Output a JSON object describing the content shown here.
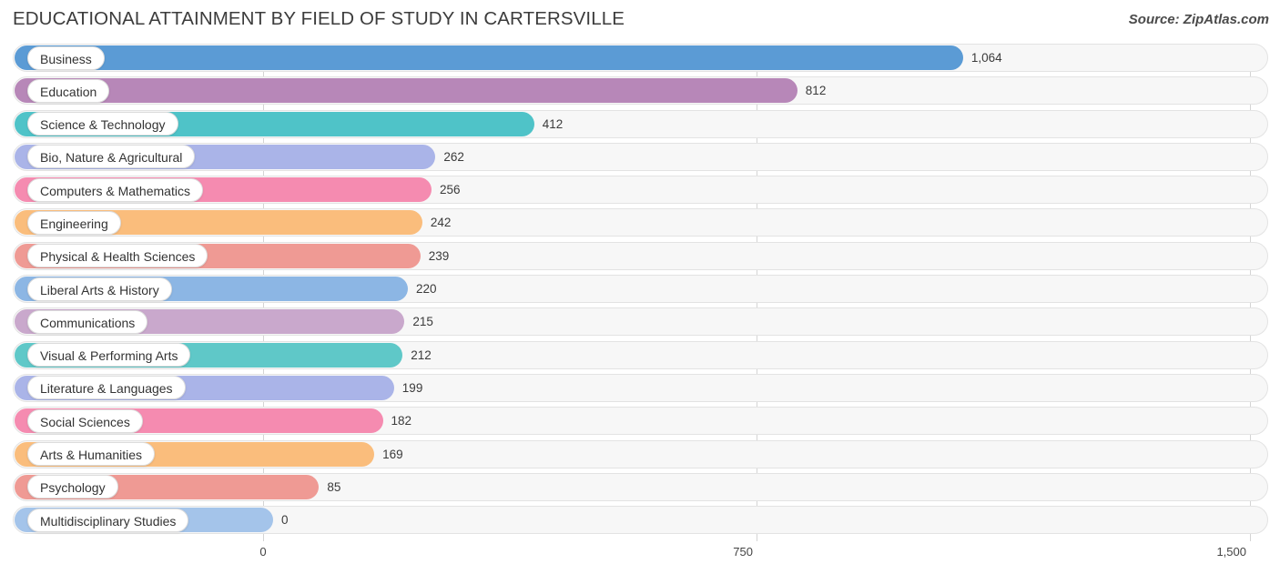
{
  "header": {
    "title": "EDUCATIONAL ATTAINMENT BY FIELD OF STUDY IN CARTERSVILLE",
    "source": "Source: ZipAtlas.com"
  },
  "chart_data": {
    "type": "bar",
    "orientation": "horizontal",
    "title": "EDUCATIONAL ATTAINMENT BY FIELD OF STUDY IN CARTERSVILLE",
    "xlabel": "",
    "ylabel": "",
    "xlim": [
      0,
      1500
    ],
    "grid": true,
    "legend": "none",
    "xticks": [
      "0",
      "750",
      "1,500"
    ],
    "xtick_values": [
      0,
      750,
      1500
    ],
    "categories": [
      "Business",
      "Education",
      "Science & Technology",
      "Bio, Nature & Agricultural",
      "Computers & Mathematics",
      "Engineering",
      "Physical & Health Sciences",
      "Liberal Arts & History",
      "Communications",
      "Visual & Performing Arts",
      "Literature & Languages",
      "Social Sciences",
      "Arts & Humanities",
      "Psychology",
      "Multidisciplinary Studies"
    ],
    "values": [
      1064,
      812,
      412,
      262,
      256,
      242,
      239,
      220,
      215,
      212,
      199,
      182,
      169,
      85,
      0
    ],
    "value_labels": [
      "1,064",
      "812",
      "412",
      "262",
      "256",
      "242",
      "239",
      "220",
      "215",
      "212",
      "199",
      "182",
      "169",
      "85",
      "0"
    ],
    "colors": [
      "#5b9bd5",
      "#b787b8",
      "#4fc3c8",
      "#aab4e8",
      "#f58bb0",
      "#fabd7c",
      "#ef9a94",
      "#8cb6e4",
      "#c9a8cc",
      "#5fc8c8",
      "#aab4e8",
      "#f58bb0",
      "#fabd7c",
      "#ef9a94",
      "#a4c4ea"
    ]
  }
}
